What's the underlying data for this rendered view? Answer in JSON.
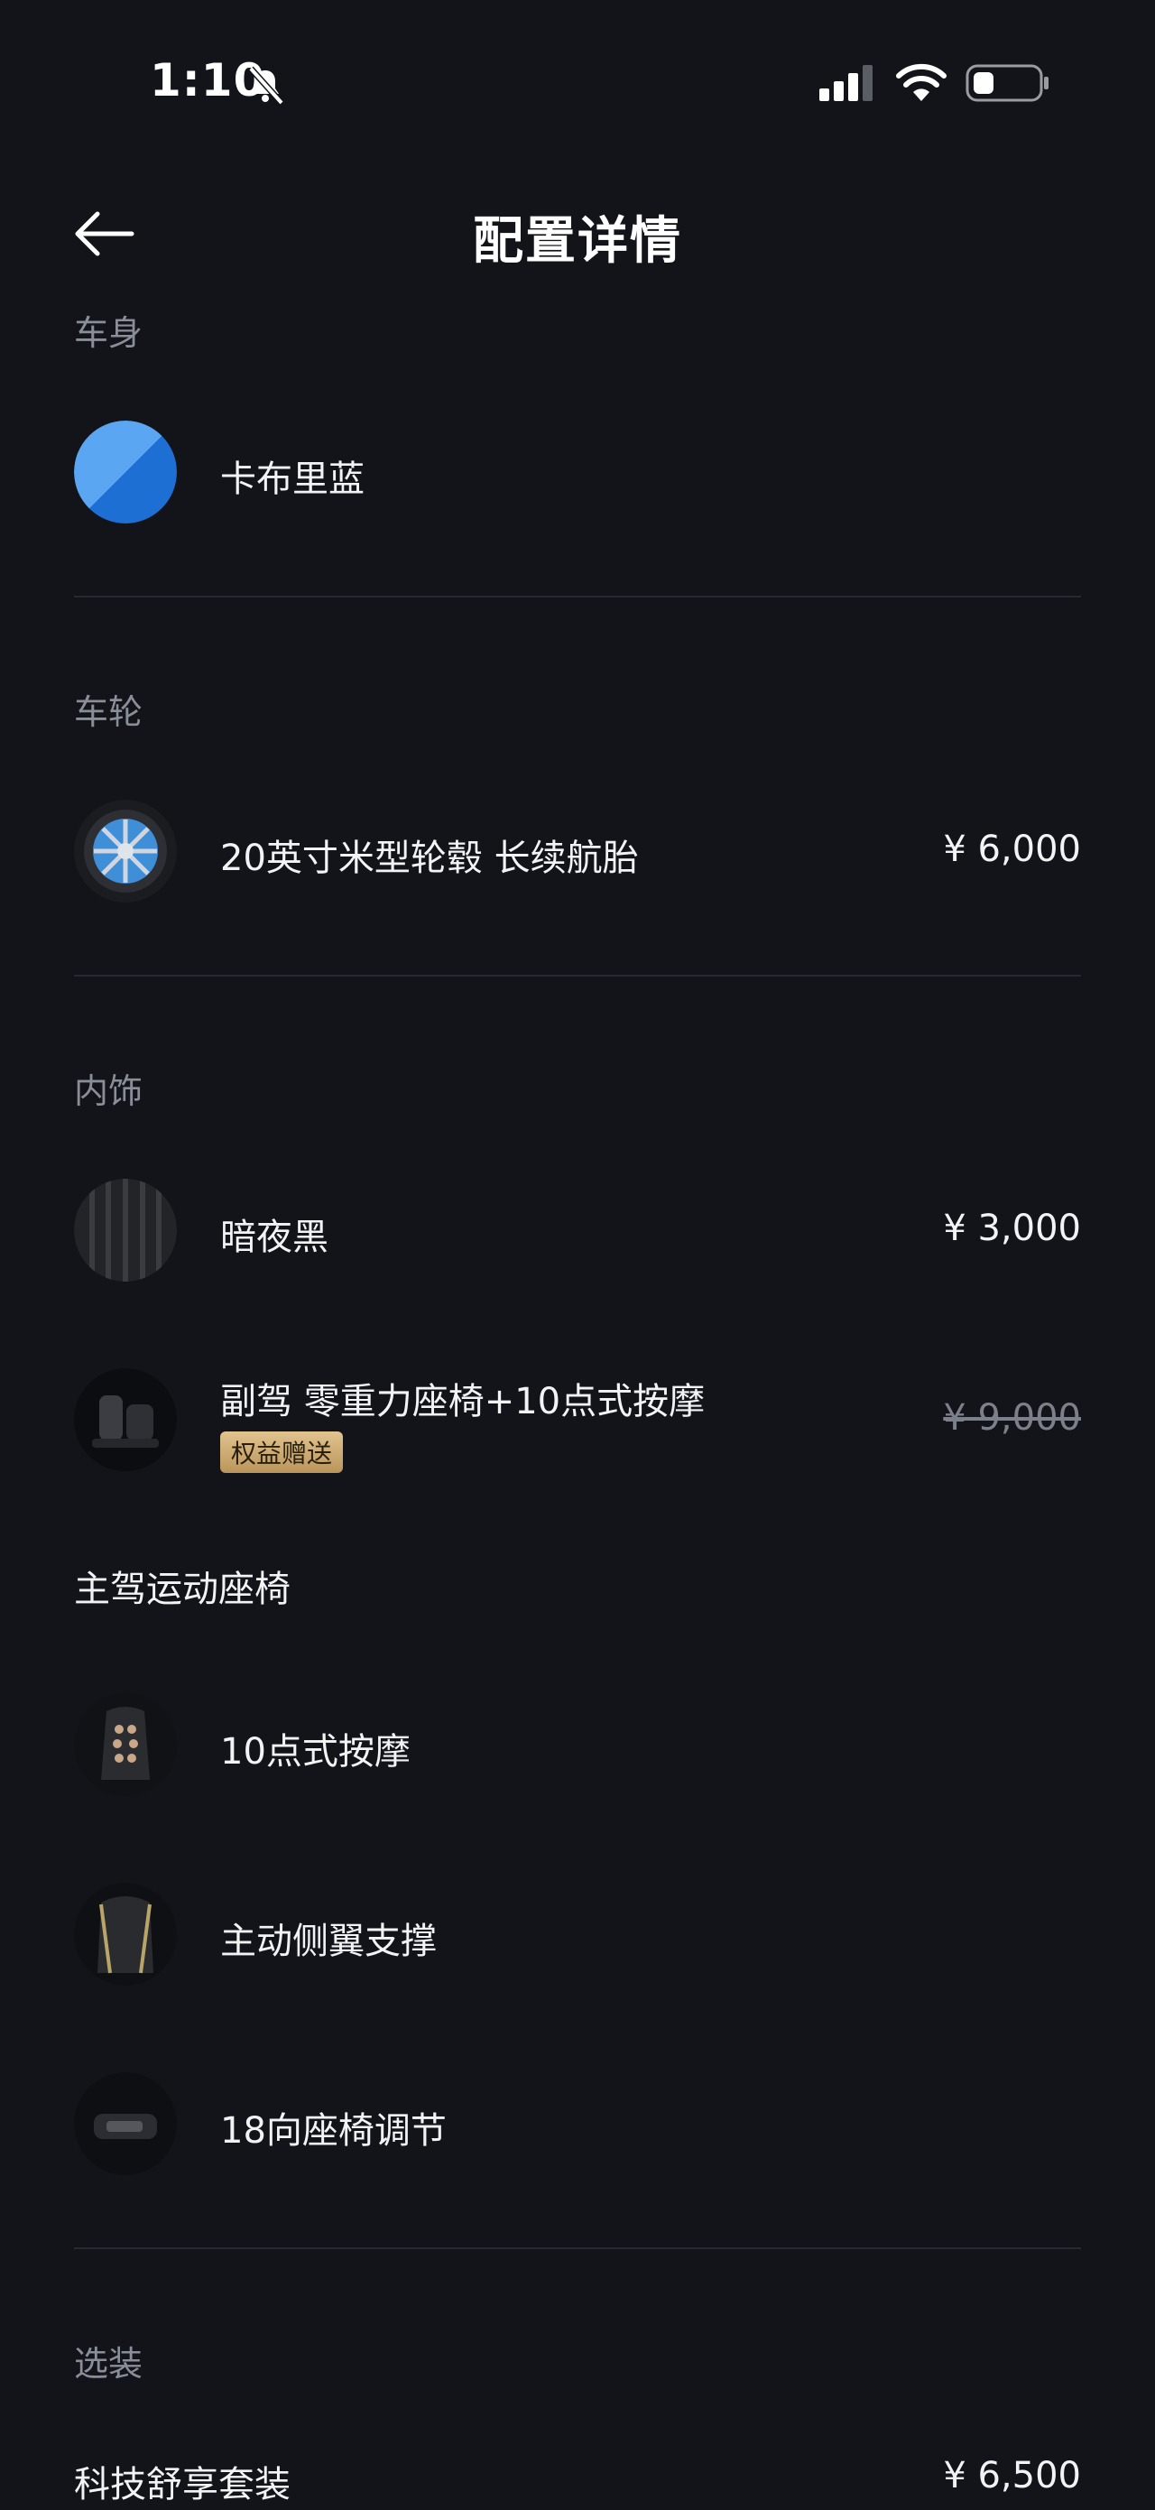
{
  "status_bar": {
    "time": "1:10"
  },
  "header": {
    "title": "配置详情"
  },
  "body_section": {
    "label": "车身",
    "color_name": "卡布里蓝",
    "swatch_colors": [
      "#5aa6f2",
      "#1e6fd4"
    ]
  },
  "wheel_section": {
    "label": "车轮",
    "name": "20英寸米型轮毂 长续航胎",
    "price": "¥ 6,000"
  },
  "interior_section": {
    "label": "内饰",
    "items": [
      {
        "name": "暗夜黑",
        "price": "¥ 3,000"
      },
      {
        "name": "副驾 零重力座椅+10点式按摩",
        "price": "¥ 9,000",
        "badge": "权益赠送"
      }
    ]
  },
  "driver_seat": {
    "title": "主驾运动座椅",
    "features": [
      "10点式按摩",
      "主动侧翼支撑",
      "18向座椅调节"
    ]
  },
  "options_section": {
    "label": "选装",
    "name": "科技舒享套装",
    "price": "¥ 6,500"
  },
  "icons": {
    "bell": "bell-muted-icon",
    "signal": "cellular-signal-icon",
    "wifi": "wifi-icon",
    "battery": "battery-icon",
    "back": "arrow-left-icon"
  }
}
